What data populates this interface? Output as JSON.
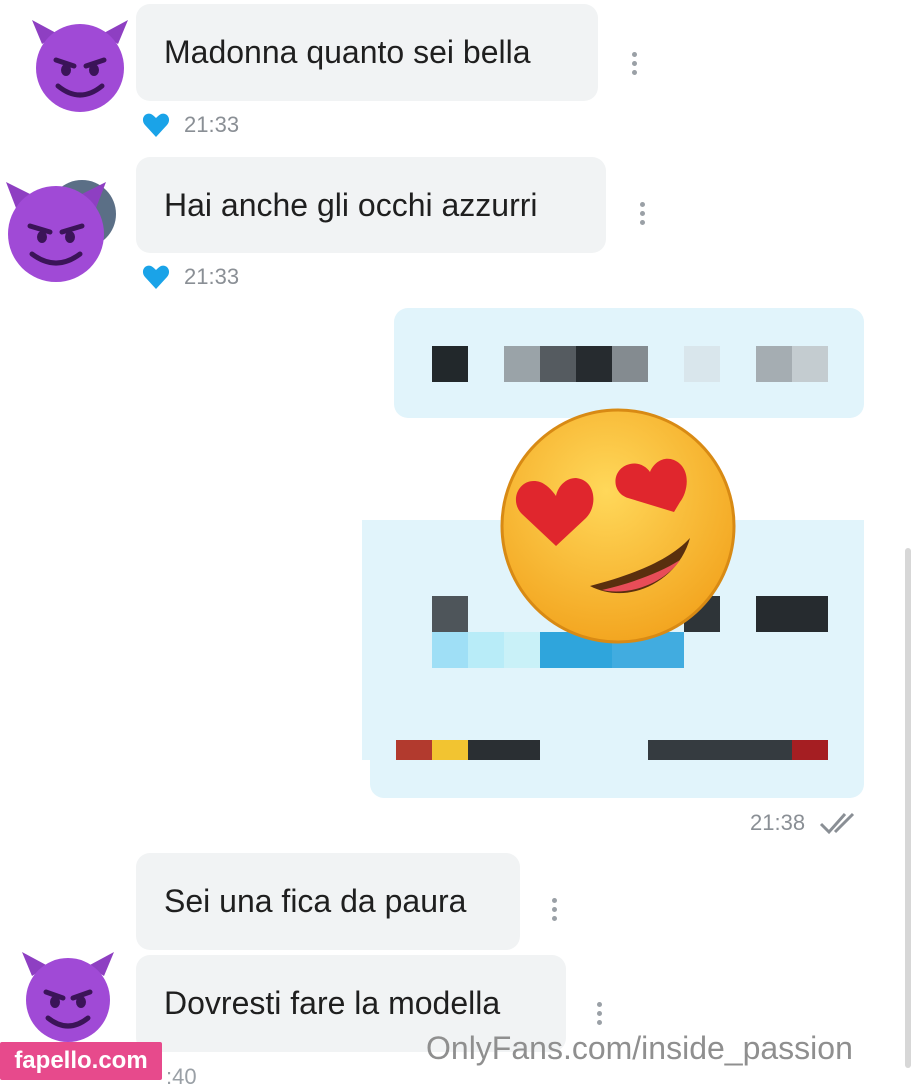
{
  "messages": [
    {
      "text": "Madonna quanto sei bella",
      "time": "21:33"
    },
    {
      "text": "Hai anche gli occhi azzurri",
      "time": "21:33"
    },
    {
      "text": "Sei una fica da paura"
    },
    {
      "text": "Dovresti fare la modella"
    }
  ],
  "sent": {
    "time": "21:38",
    "status_icon": "double-check-icon"
  },
  "last_time_partial": ":40",
  "overlay": {
    "badge": "fapello.com",
    "watermark": "OnlyFans.com/inside_passion"
  },
  "colors": {
    "bubble_in": "#f1f3f4",
    "bubble_out": "#e1f4fb",
    "heart": "#1aa3e8",
    "badge": "#e74a8c"
  },
  "icons": {
    "avatar": "smiling-devil-emoji",
    "reaction": "heart-icon",
    "menu": "kebab-menu-icon",
    "sticker": "heart-eyes-emoji"
  }
}
